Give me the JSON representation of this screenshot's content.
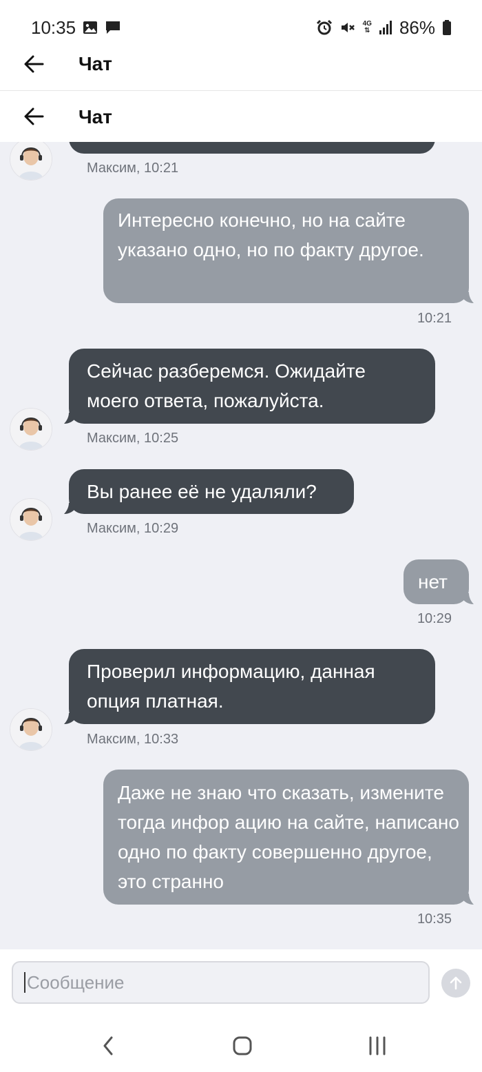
{
  "status_bar": {
    "time": "10:35",
    "battery": "86%",
    "network": "4G"
  },
  "header_top": {
    "title": "Чат"
  },
  "header": {
    "title": "Чат"
  },
  "messages": [
    {
      "type": "in",
      "text": "",
      "author": "Максим",
      "time": "10:21",
      "meta": "Максим, 10:21"
    },
    {
      "type": "out",
      "text": "Интересно конечно, но на сайте указано одно, но по факту другое.",
      "time": "10:21"
    },
    {
      "type": "in",
      "text": "Сейчас разберемся. Ожидайте моего ответа, пожалуйста.",
      "meta": "Максим, 10:25"
    },
    {
      "type": "in",
      "text": "Вы ранее её не удаляли?",
      "meta": "Максим, 10:29"
    },
    {
      "type": "out",
      "text": "нет",
      "time": "10:29"
    },
    {
      "type": "in",
      "text": "Проверил информацию, данная опция платная.",
      "meta": "Максим, 10:33"
    },
    {
      "type": "out",
      "text": "Даже не знаю что сказать, измените тогда инфор ацию на сайте, написано одно по факту совершенно другое, это странно",
      "time": "10:35"
    }
  ],
  "input": {
    "placeholder": "Сообщение"
  },
  "icons": {
    "back": "arrow-left-icon",
    "send": "arrow-up-icon",
    "nav_back": "chevron-left-icon",
    "nav_home": "home-icon",
    "nav_recents": "recents-icon"
  },
  "colors": {
    "incoming_bubble": "#42484f",
    "outgoing_bubble": "#969ca4",
    "chat_background": "#eff0f5"
  }
}
